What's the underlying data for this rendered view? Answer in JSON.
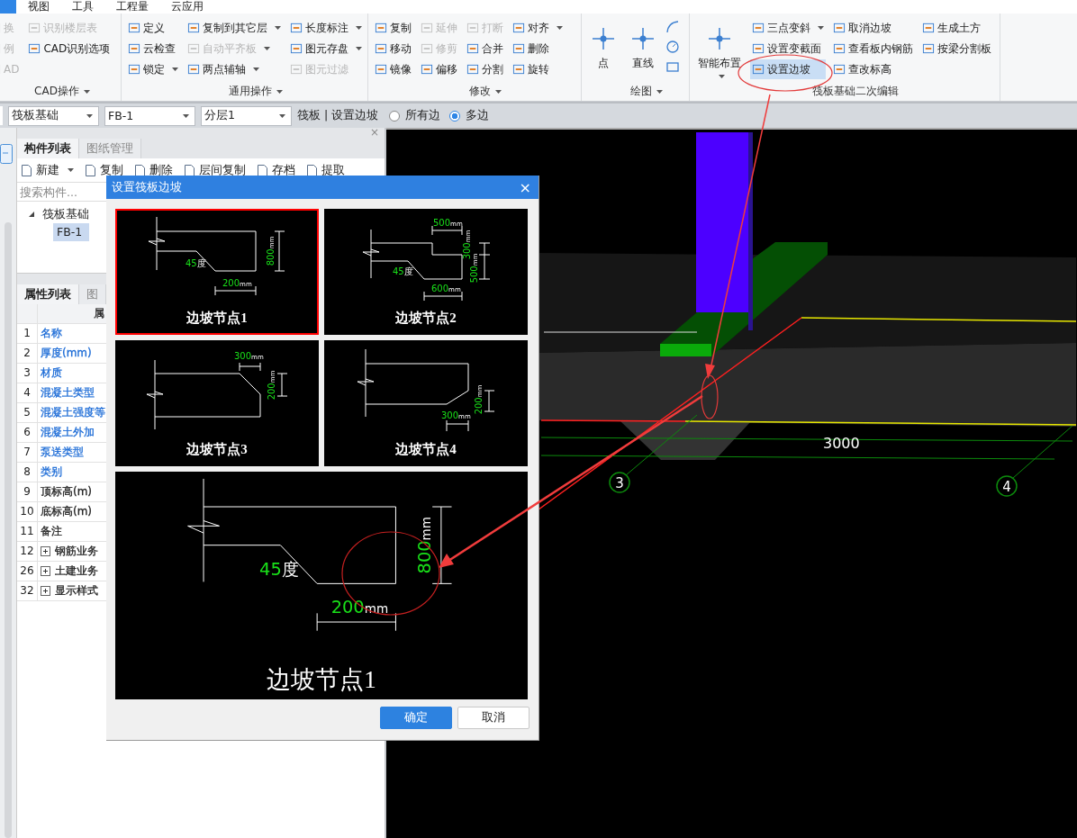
{
  "menu": [
    {
      "selected": true
    },
    {
      "label": "视图",
      "selected": false
    },
    {
      "label": "工具",
      "selected": false
    },
    {
      "label": "工程量",
      "selected": false
    },
    {
      "label": "云应用",
      "selected": false
    }
  ],
  "ribbon": {
    "groups": [
      {
        "title": "CAD操作",
        "dropdown": true,
        "kind": "plain",
        "columns": [
          [
            {
              "label": "换",
              "disabled": true,
              "dropdown": false,
              "selected": false
            },
            {
              "label": "例",
              "disabled": true,
              "dropdown": false,
              "selected": false
            },
            {
              "label": "AD",
              "disabled": true,
              "dropdown": false,
              "selected": false
            }
          ],
          [
            {
              "label": "识别楼层表",
              "disabled": true,
              "dropdown": false,
              "selected": false
            },
            {
              "label": "CAD识别选项",
              "disabled": false,
              "dropdown": false,
              "selected": false
            }
          ]
        ]
      },
      {
        "title": "通用操作",
        "dropdown": true,
        "kind": "plain",
        "columns": [
          [
            {
              "label": "定义",
              "disabled": false,
              "dropdown": false,
              "selected": false
            },
            {
              "label": "云检查",
              "disabled": false,
              "dropdown": false,
              "selected": false
            },
            {
              "label": "锁定",
              "disabled": false,
              "dropdown": true,
              "selected": false
            }
          ],
          [
            {
              "label": "复制到其它层",
              "disabled": false,
              "dropdown": true,
              "selected": false
            },
            {
              "label": "自动平齐板",
              "disabled": true,
              "dropdown": true,
              "selected": false
            },
            {
              "label": "两点辅轴",
              "disabled": false,
              "dropdown": true,
              "selected": false
            }
          ],
          [
            {
              "label": "长度标注",
              "disabled": false,
              "dropdown": true,
              "selected": false
            },
            {
              "label": "图元存盘",
              "disabled": false,
              "dropdown": true,
              "selected": false
            },
            {
              "label": "图元过滤",
              "disabled": true,
              "dropdown": false,
              "selected": false
            }
          ]
        ]
      },
      {
        "title": "修改",
        "dropdown": true,
        "kind": "plain",
        "columns": [
          [
            {
              "label": "复制",
              "disabled": false,
              "dropdown": false,
              "selected": false
            },
            {
              "label": "移动",
              "disabled": false,
              "dropdown": false,
              "selected": false
            },
            {
              "label": "镜像",
              "disabled": false,
              "dropdown": false,
              "selected": false
            }
          ],
          [
            {
              "label": "延伸",
              "disabled": true,
              "dropdown": false,
              "selected": false
            },
            {
              "label": "修剪",
              "disabled": true,
              "dropdown": false,
              "selected": false
            },
            {
              "label": "偏移",
              "disabled": false,
              "dropdown": false,
              "selected": false
            }
          ],
          [
            {
              "label": "打断",
              "disabled": true,
              "dropdown": false,
              "selected": false
            },
            {
              "label": "合并",
              "disabled": false,
              "dropdown": false,
              "selected": false
            },
            {
              "label": "分割",
              "disabled": false,
              "dropdown": false,
              "selected": false
            }
          ],
          [
            {
              "label": "对齐",
              "disabled": false,
              "dropdown": true,
              "selected": false
            },
            {
              "label": "删除",
              "disabled": false,
              "dropdown": false,
              "selected": false
            },
            {
              "label": "旋转",
              "disabled": false,
              "dropdown": false,
              "selected": false
            }
          ]
        ]
      },
      {
        "title": "绘图",
        "dropdown": true,
        "kind": "draw",
        "large": [
          {
            "label": "点",
            "dropdown": false
          },
          {
            "label": "直线",
            "dropdown": false
          }
        ]
      },
      {
        "title": "筏板基础二次编辑",
        "dropdown": false,
        "kind": "plain",
        "large": [
          {
            "label": "智能布置",
            "dropdown": true
          }
        ],
        "columns": [
          [
            {
              "label": "三点变斜",
              "disabled": false,
              "dropdown": true,
              "selected": false
            },
            {
              "label": "设置变截面",
              "disabled": false,
              "dropdown": false,
              "selected": false
            },
            {
              "label": "设置边坡",
              "disabled": false,
              "dropdown": false,
              "selected": true
            }
          ],
          [
            {
              "label": "取消边坡",
              "disabled": false,
              "dropdown": false,
              "selected": false
            },
            {
              "label": "查看板内钢筋",
              "disabled": false,
              "dropdown": false,
              "selected": false
            },
            {
              "label": "查改标高",
              "disabled": false,
              "dropdown": false,
              "selected": false
            }
          ],
          [
            {
              "label": "生成土方",
              "disabled": false,
              "dropdown": false,
              "selected": false
            },
            {
              "label": "按梁分割板",
              "disabled": false,
              "dropdown": false,
              "selected": false
            }
          ]
        ]
      }
    ]
  },
  "toolbar": {
    "selects": [
      "筏板基础",
      "FB-1",
      "分层1"
    ],
    "mode_label": "筏板 | 设置边坡",
    "radios": [
      {
        "label": "所有边",
        "selected": false
      },
      {
        "label": "多边",
        "selected": true
      }
    ]
  },
  "component_panel": {
    "close": "×",
    "tabs": [
      {
        "label": "构件列表",
        "selected": true
      },
      {
        "label": "图纸管理",
        "selected": false
      }
    ],
    "actions": [
      {
        "label": "新建",
        "dropdown": true
      },
      {
        "label": "复制",
        "dropdown": false
      },
      {
        "label": "删除",
        "dropdown": false
      },
      {
        "label": "层间复制",
        "dropdown": false
      },
      {
        "label": "存档",
        "dropdown": false
      },
      {
        "label": "提取",
        "dropdown": false
      }
    ],
    "search": {
      "placeholder": "搜索构件..."
    },
    "tree": [
      {
        "label": "筏板基础",
        "expanded": true,
        "selected": false,
        "children": [
          {
            "label": "FB-1",
            "selected": true
          }
        ]
      }
    ]
  },
  "property_panel": {
    "tabs": [
      {
        "label": "属性列表",
        "selected": true
      },
      {
        "label": "图",
        "selected": false
      }
    ],
    "header": "属",
    "rows": [
      {
        "index": "1",
        "name": "名称",
        "color": "#1a6ad6",
        "expandable": false
      },
      {
        "index": "2",
        "name": "厚度(mm)",
        "color": "#1a6ad6",
        "expandable": false
      },
      {
        "index": "3",
        "name": "材质",
        "color": "#1a6ad6",
        "expandable": false
      },
      {
        "index": "4",
        "name": "混凝土类型",
        "color": "#1a6ad6",
        "expandable": false
      },
      {
        "index": "5",
        "name": "混凝土强度等",
        "color": "#1a6ad6",
        "expandable": false
      },
      {
        "index": "6",
        "name": "混凝土外加",
        "color": "#1a6ad6",
        "expandable": false
      },
      {
        "index": "7",
        "name": "泵送类型",
        "color": "#1a6ad6",
        "expandable": false
      },
      {
        "index": "8",
        "name": "类别",
        "color": "#1a6ad6",
        "expandable": false
      },
      {
        "index": "9",
        "name": "顶标高(m)",
        "color": "#222222",
        "expandable": false
      },
      {
        "index": "10",
        "name": "底标高(m)",
        "color": "#222222",
        "expandable": false
      },
      {
        "index": "11",
        "name": "备注",
        "color": "#222222",
        "expandable": false
      },
      {
        "index": "12",
        "name": "钢筋业务",
        "color": "#222222",
        "expandable": true
      },
      {
        "index": "26",
        "name": "土建业务",
        "color": "#222222",
        "expandable": true
      },
      {
        "index": "32",
        "name": "显示样式",
        "color": "#222222",
        "expandable": true
      }
    ]
  },
  "viewport": {
    "dimension": "3000",
    "axes": [
      "3",
      "4"
    ]
  },
  "dialog": {
    "title": "设置筏板边坡",
    "close": "×",
    "options": [
      {
        "kind": "node1",
        "title": "边坡节点1",
        "selected": true,
        "angle": {
          "value": "45",
          "unit": "度"
        },
        "dims": [
          {
            "value": "200",
            "unit": "mm"
          },
          {
            "value": "800",
            "unit": "mm"
          }
        ]
      },
      {
        "kind": "node2",
        "title": "边坡节点2",
        "selected": false,
        "angle": {
          "value": "45",
          "unit": "度"
        },
        "dims": [
          {
            "value": "500",
            "unit": "mm"
          },
          {
            "value": "300",
            "unit": "mm"
          },
          {
            "value": "500",
            "unit": "mm"
          },
          {
            "value": "600",
            "unit": "mm"
          }
        ]
      },
      {
        "kind": "node3",
        "title": "边坡节点3",
        "selected": false,
        "dims": [
          {
            "value": "300",
            "unit": "mm"
          },
          {
            "value": "200",
            "unit": "mm"
          }
        ]
      },
      {
        "kind": "node4",
        "title": "边坡节点4",
        "selected": false,
        "dims": [
          {
            "value": "200",
            "unit": "mm"
          },
          {
            "value": "300",
            "unit": "mm"
          }
        ]
      }
    ],
    "preview": {
      "kind": "node1",
      "title": "边坡节点1",
      "angle": {
        "value": "45",
        "unit": "度"
      },
      "dims": [
        {
          "value": "200",
          "unit": "mm"
        },
        {
          "value": "800",
          "unit": "mm"
        }
      ]
    },
    "buttons": [
      {
        "label": "确定",
        "primary": true
      },
      {
        "label": "取消",
        "primary": false
      }
    ]
  }
}
